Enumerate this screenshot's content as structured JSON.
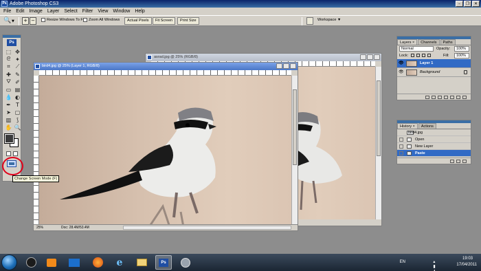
{
  "app": {
    "title": "Adobe Photoshop CS3",
    "logo": "Ps"
  },
  "menu": [
    "File",
    "Edit",
    "Image",
    "Layer",
    "Select",
    "Filter",
    "View",
    "Window",
    "Help"
  ],
  "options": {
    "resize_windows": "Resize Windows To Fit",
    "zoom_all_windows": "Zoom All Windows",
    "actual_pixels": "Actual Pixels",
    "fit_screen": "Fit Screen",
    "print_size": "Print Size",
    "workspace": "Workspace ▼"
  },
  "tooltip": "Change Screen Mode (F)",
  "documents": {
    "back": {
      "title": "asrad.jpg @ 25% (RGB/8)"
    },
    "front": {
      "title": "bird4.jpg @ 25% (Layer 1, RGB/8)",
      "zoom": "25%",
      "doc_size": "Doc: 28.4M/53.4M"
    }
  },
  "layers_panel": {
    "tabs": [
      "Layers ×",
      "Channels",
      "Paths"
    ],
    "blend_mode": "Normal",
    "opacity_label": "Opacity:",
    "opacity": "100%",
    "lock_label": "Lock:",
    "fill_label": "Fill:",
    "fill": "100%",
    "layers": [
      {
        "name": "Layer 1"
      },
      {
        "name": "Background"
      }
    ]
  },
  "history_panel": {
    "tabs": [
      "History ×",
      "Actions"
    ],
    "snapshot": "bird4.jpg",
    "states": [
      "Open",
      "New Layer",
      "Paste"
    ]
  },
  "tray": {
    "language": "EN",
    "time": "19:03",
    "date": "17/04/2011"
  }
}
